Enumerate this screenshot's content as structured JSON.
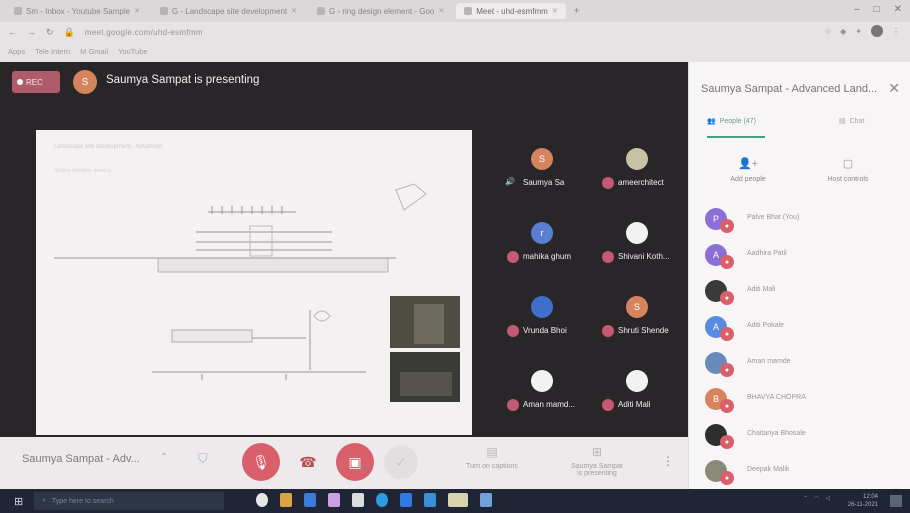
{
  "browser": {
    "tabs": [
      {
        "label": "Sm - Inbox - Youtube Sample",
        "active": false
      },
      {
        "label": "G - Landscape site development",
        "active": false
      },
      {
        "label": "G - ring design element - Goo",
        "active": false
      },
      {
        "label": "Meet - uhd-esmfmm",
        "active": true
      }
    ],
    "new_tab": "+",
    "address": "meet.google.com/uhd-esmfmm",
    "bookmarks": [
      "Apps",
      "Tele Intern",
      "M Gmail",
      "YouTube"
    ],
    "window_controls": [
      "–",
      "□",
      "✕"
    ]
  },
  "meeting": {
    "rec_label": "REC",
    "presenter_initial": "S",
    "presenting_text": "Saumya Sampat is presenting",
    "meeting_title": "Saumya Sampat - Adv...",
    "slide_heading": "Landscape site development - Advanced",
    "slide_sub": "Section elevation drawing",
    "tiles": [
      {
        "name": "Saumya Sa",
        "initial": "S",
        "color": "#d6845e",
        "speaking": true
      },
      {
        "name": "ameerchitect",
        "initial": "",
        "color": "#c7c2a3",
        "speaking": false
      },
      {
        "name": "mahika ghum",
        "initial": "r",
        "color": "#5b7fd0",
        "speaking": false
      },
      {
        "name": "Shivani Koth...",
        "initial": "",
        "color": "#f2f2f2",
        "speaking": false
      },
      {
        "name": "Vrunda Bhoi",
        "initial": "",
        "color": "#3e6fc9",
        "speaking": false
      },
      {
        "name": "Shruti Shende",
        "initial": "S",
        "color": "#d6845e",
        "speaking": false
      },
      {
        "name": "Aman mamd...",
        "initial": "",
        "color": "#f2f2f2",
        "speaking": false
      },
      {
        "name": "Aditi Mali",
        "initial": "",
        "color": "#f2f2f2",
        "speaking": false
      }
    ]
  },
  "bottom_bar": {
    "turn_on_captions": "Turn on captions",
    "presenting_label": "Saumya Sampat\nis presenting",
    "more_icon": "⋮"
  },
  "panel": {
    "title": "Saumya Sampat - Advanced Land...",
    "people_tab": "People (47)",
    "chat_tab": "Chat",
    "add_people": "Add people",
    "host_controls": "Host controls",
    "people": [
      {
        "name": "Palve Bhat (You)",
        "initial": "P",
        "color": "#8b6fd6"
      },
      {
        "name": "Aadhira Patil",
        "initial": "A",
        "color": "#8b6fd6"
      },
      {
        "name": "Aditi Mali",
        "initial": "",
        "color": "#3a3a3a"
      },
      {
        "name": "Aditi Pokale",
        "initial": "A",
        "color": "#5b8be0"
      },
      {
        "name": "Aman mamde",
        "initial": "",
        "color": "#6a8bb8"
      },
      {
        "name": "BHAVYA CHOPRA",
        "initial": "B",
        "color": "#d6845e"
      },
      {
        "name": "Chaitanya Bhosale",
        "initial": "",
        "color": "#2e2e2e"
      },
      {
        "name": "Deepak Malik",
        "initial": "",
        "color": "#8a8a7a"
      }
    ]
  },
  "taskbar": {
    "search_placeholder": "Type here to search",
    "clock_time": "12:04",
    "clock_date": "26-11-2021",
    "apps": [
      "#e6e6e6",
      "#d9a441",
      "#3b7bd9",
      "#c9a0e0",
      "#dcdcdc",
      "#2f9be0",
      "#2f7be0",
      "#3a8fd9",
      "#d9d4b0",
      "#6fa0d8"
    ]
  }
}
